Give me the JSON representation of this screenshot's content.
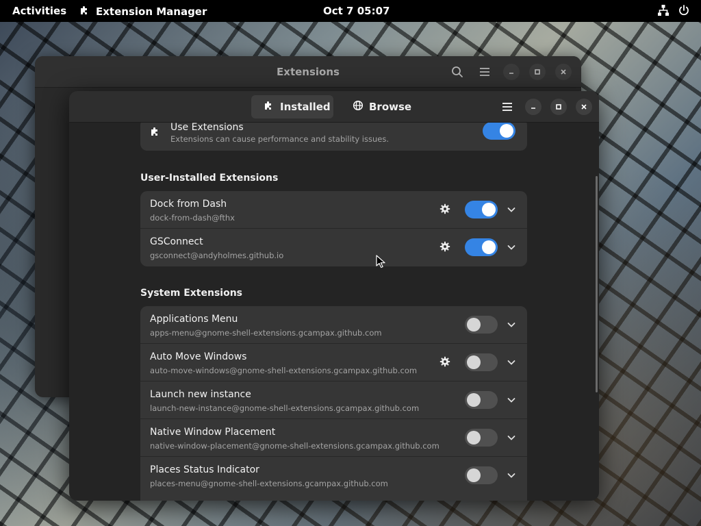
{
  "topbar": {
    "activities": "Activities",
    "app_name": "Extension Manager",
    "clock": "Oct 7  05:07",
    "icons": [
      "network-icon",
      "power-icon"
    ]
  },
  "back_window": {
    "title": "Extensions",
    "icons": [
      "search-icon",
      "menu-icon",
      "minimize-icon",
      "maximize-icon",
      "close-icon"
    ]
  },
  "front_window": {
    "tabs": [
      {
        "label": "Installed",
        "icon": "puzzle-icon",
        "active": true
      },
      {
        "label": "Browse",
        "icon": "globe-icon",
        "active": false
      }
    ],
    "icons": [
      "menu-icon",
      "minimize-icon",
      "maximize-icon",
      "close-icon"
    ]
  },
  "use_extensions": {
    "title": "Use Extensions",
    "subtitle": "Extensions can cause performance and stability issues.",
    "enabled": true
  },
  "user_section": {
    "heading": "User-Installed Extensions",
    "items": [
      {
        "name": "Dock from Dash",
        "uuid": "dock-from-dash@fthx",
        "has_settings": true,
        "enabled": true
      },
      {
        "name": "GSConnect",
        "uuid": "gsconnect@andyholmes.github.io",
        "has_settings": true,
        "enabled": true
      }
    ]
  },
  "system_section": {
    "heading": "System Extensions",
    "items": [
      {
        "name": "Applications Menu",
        "uuid": "apps-menu@gnome-shell-extensions.gcampax.github.com",
        "has_settings": false,
        "enabled": false
      },
      {
        "name": "Auto Move Windows",
        "uuid": "auto-move-windows@gnome-shell-extensions.gcampax.github.com",
        "has_settings": true,
        "enabled": false
      },
      {
        "name": "Launch new instance",
        "uuid": "launch-new-instance@gnome-shell-extensions.gcampax.github.com",
        "has_settings": false,
        "enabled": false
      },
      {
        "name": "Native Window Placement",
        "uuid": "native-window-placement@gnome-shell-extensions.gcampax.github.com",
        "has_settings": false,
        "enabled": false
      },
      {
        "name": "Places Status Indicator",
        "uuid": "places-menu@gnome-shell-extensions.gcampax.github.com",
        "has_settings": false,
        "enabled": false
      }
    ]
  },
  "colors": {
    "accent": "#3584e4",
    "window_bg": "#242424",
    "card_bg": "#363636",
    "topbar_bg": "#000000"
  }
}
